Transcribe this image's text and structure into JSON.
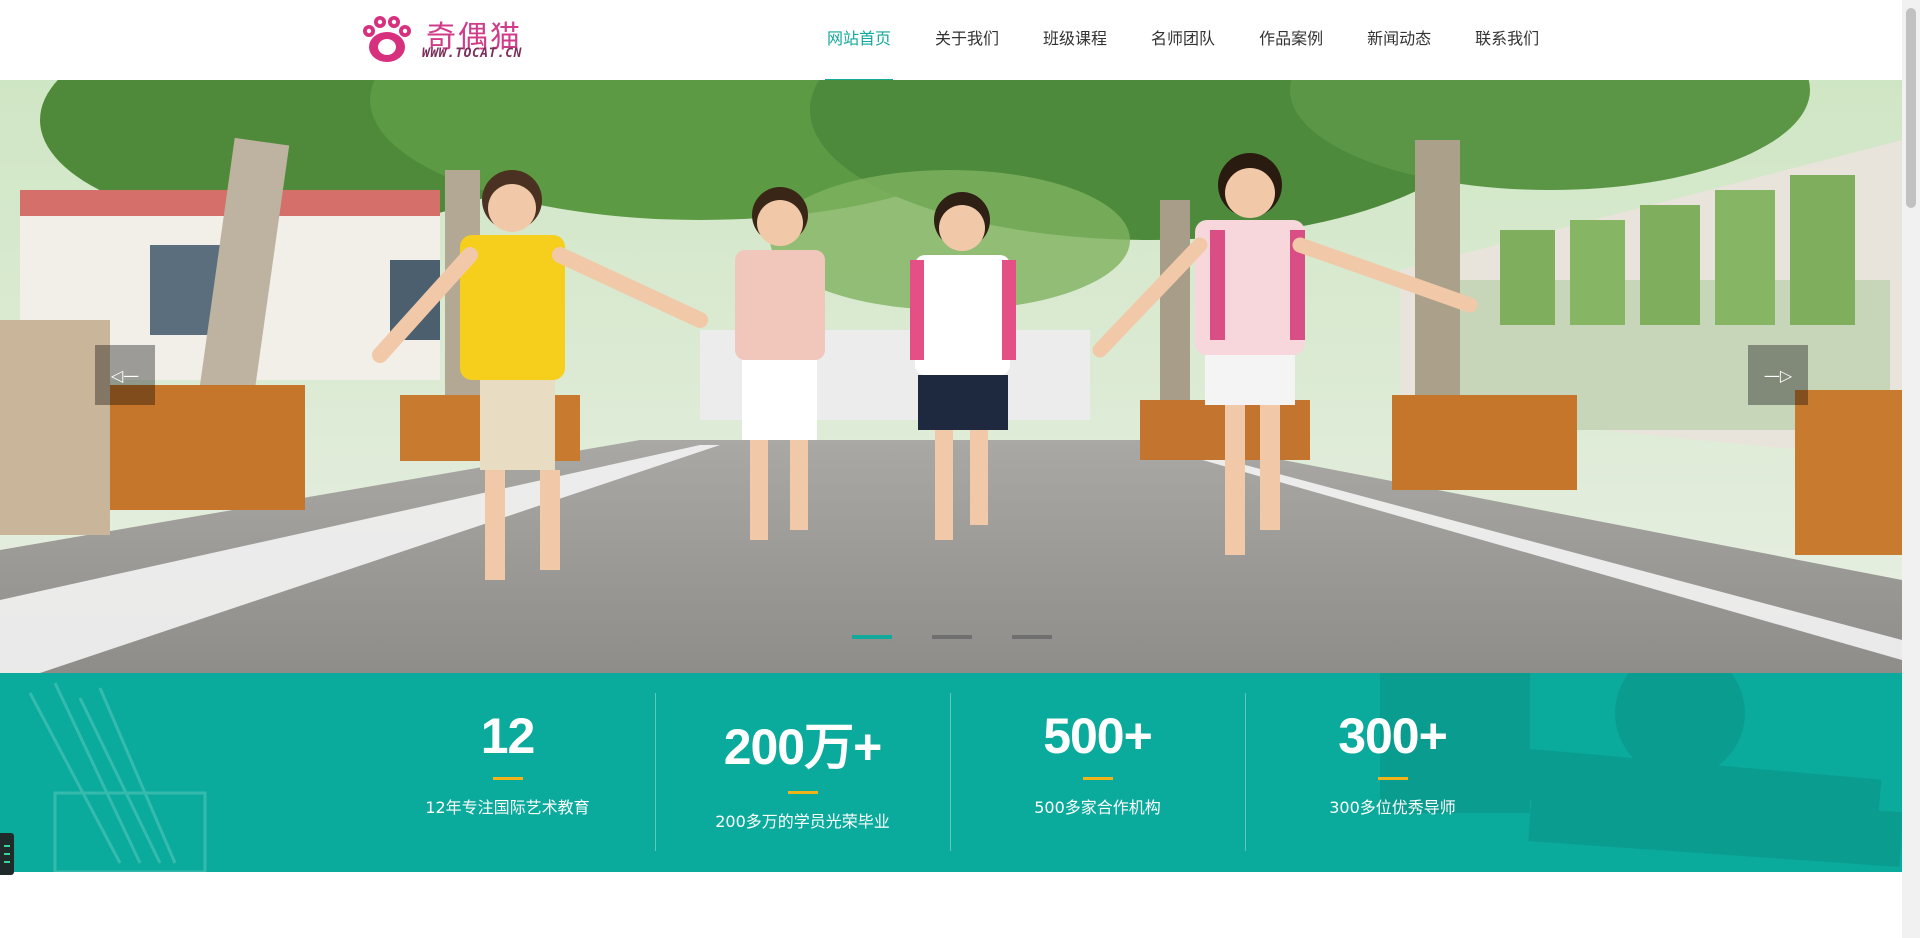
{
  "logo": {
    "brand": "奇偶猫",
    "url": "WWW.TOCAT.CN"
  },
  "nav": {
    "items": [
      {
        "label": "网站首页",
        "active": true
      },
      {
        "label": "关于我们"
      },
      {
        "label": "班级课程"
      },
      {
        "label": "名师团队"
      },
      {
        "label": "作品案例"
      },
      {
        "label": "新闻动态"
      },
      {
        "label": "联系我们"
      }
    ]
  },
  "hero": {
    "prev_arrow": "◁—",
    "next_arrow": "—▷",
    "slide_count": 3,
    "active_slide": 1
  },
  "stats": [
    {
      "number": "12",
      "text": "12年专注国际艺术教育"
    },
    {
      "number": "200万+",
      "text": "200多万的学员光荣毕业"
    },
    {
      "number": "500+",
      "text": "500多家合作机构"
    },
    {
      "number": "300+",
      "text": "300多位优秀导师"
    }
  ],
  "colors": {
    "accent": "#12a99b",
    "stats_bg": "#0aab9c",
    "underline": "#f2b318"
  }
}
